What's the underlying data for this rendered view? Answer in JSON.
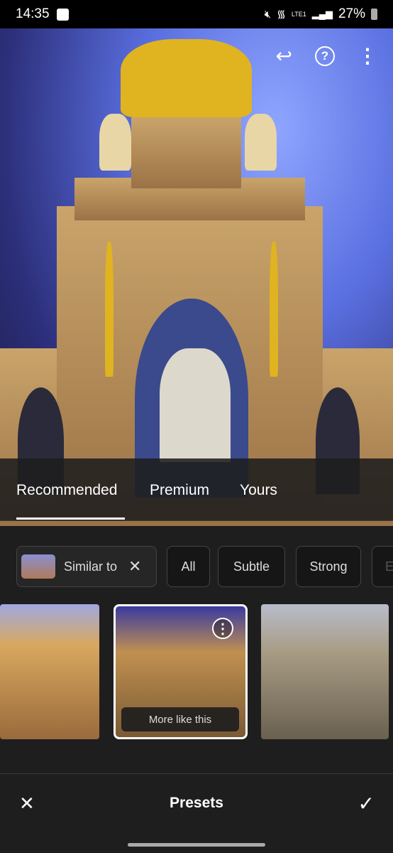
{
  "status_bar": {
    "time": "14:35",
    "battery": "27%",
    "network": "LTE1"
  },
  "toolbar": {
    "icons": [
      "undo-icon",
      "help-icon",
      "more-vert-icon"
    ]
  },
  "tabs": [
    {
      "label": "Recommended",
      "active": true
    },
    {
      "label": "Premium"
    },
    {
      "label": "Yours"
    }
  ],
  "filters": {
    "similar_label": "Similar to",
    "chips": [
      "All",
      "Subtle",
      "Strong",
      "E"
    ]
  },
  "preset_menu": {
    "label": "More like this"
  },
  "bottom_bar": {
    "title": "Presets"
  }
}
